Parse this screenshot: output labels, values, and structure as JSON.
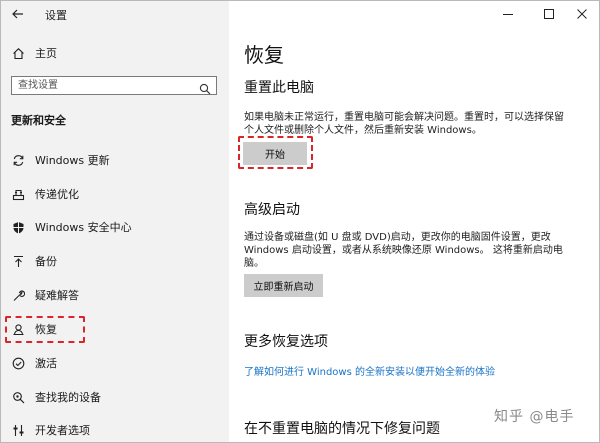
{
  "window": {
    "title": "设置",
    "back_icon": "back-arrow-icon",
    "controls": [
      "minimize-icon",
      "maximize-icon",
      "close-icon"
    ]
  },
  "sidebar": {
    "home_label": "主页",
    "search_placeholder": "查找设置",
    "section_title": "更新和安全",
    "items": [
      {
        "label": "Windows 更新",
        "icon": "sync-icon"
      },
      {
        "label": "传递优化",
        "icon": "delivery-optimization-icon"
      },
      {
        "label": "Windows 安全中心",
        "icon": "shield-icon"
      },
      {
        "label": "备份",
        "icon": "backup-arrow-icon"
      },
      {
        "label": "疑难解答",
        "icon": "wrench-icon"
      },
      {
        "label": "恢复",
        "icon": "recovery-icon",
        "selected": true
      },
      {
        "label": "激活",
        "icon": "check-circle-icon"
      },
      {
        "label": "查找我的设备",
        "icon": "find-device-icon"
      },
      {
        "label": "开发者选项",
        "icon": "developer-icon"
      }
    ]
  },
  "main": {
    "title": "恢复",
    "reset": {
      "heading": "重置此电脑",
      "description": "如果电脑未正常运行，重置电脑可能会解决问题。重置时，可以选择保留个人文件或删除个人文件，然后重新安装 Windows。",
      "button": "开始"
    },
    "advanced": {
      "heading": "高级启动",
      "description": "通过设备或磁盘(如 U 盘或 DVD)启动，更改你的电脑固件设置，更改 Windows 启动设置，或者从系统映像还原 Windows。 这将重新启动电脑。",
      "button": "立即重新启动"
    },
    "more": {
      "heading": "更多恢复选项",
      "link": "了解如何进行 Windows 的全新安装以便开始全新的体验"
    },
    "fix": {
      "heading": "在不重置电脑的情况下修复问题"
    }
  },
  "watermark": "知乎 @电手",
  "colors": {
    "sidebar_bg": "#f2f2f2",
    "accent": "#0078d7",
    "link": "#1a73c8",
    "highlight": "#d9262a",
    "button_bg": "#cccccc"
  }
}
